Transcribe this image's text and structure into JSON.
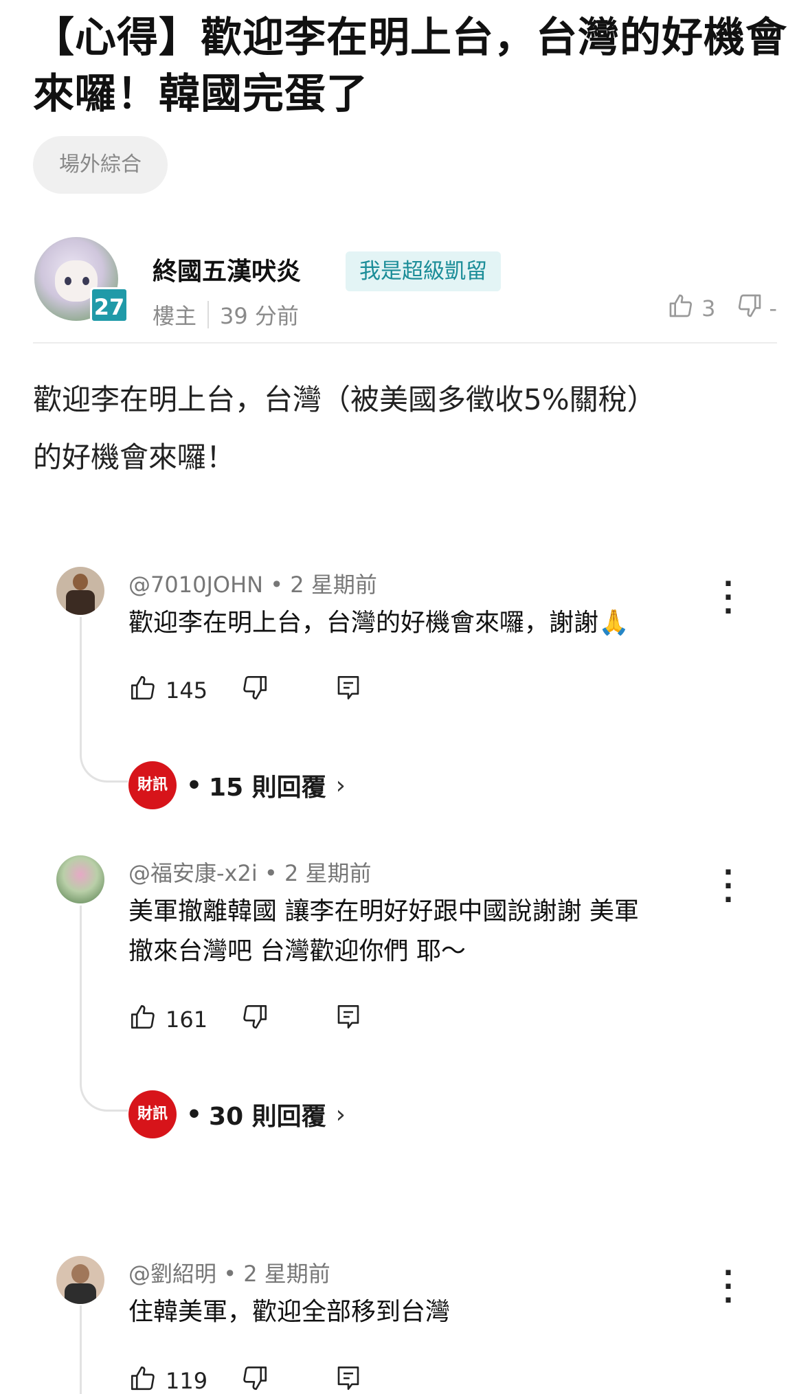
{
  "post": {
    "title": "【心得】歡迎李在明上台，台灣的好機會來囉！韓國完蛋了",
    "board": "場外綜合",
    "author": {
      "name": "終國五漢吠炎",
      "level": "27",
      "badge": "我是超級凱留",
      "role": "樓主",
      "time": "39 分前"
    },
    "likes": "3",
    "dislikes": "-",
    "body_line1": "歡迎李在明上台，台灣（被美國多徵收5%關稅）",
    "body_line2": "的好機會來囉！"
  },
  "comments": [
    {
      "user": "@7010JOHN",
      "time": "2 星期前",
      "text": "歡迎李在明上台，台灣的好機會來囉，謝謝🙏",
      "likes": "145",
      "reply_logo": "財訊",
      "replies": "15 則回覆"
    },
    {
      "user": "@福安康-x2i",
      "time": "2 星期前",
      "text_line1": "美軍撤離韓國 讓李在明好好跟中國說謝謝 美軍",
      "text_line2": "撤來台灣吧 台灣歡迎你們 耶～",
      "likes": "161",
      "reply_logo": "財訊",
      "replies": "30 則回覆"
    },
    {
      "user": "@劉紹明",
      "time": "2 星期前",
      "text": "住韓美軍，歡迎全部移到台灣",
      "likes": "119"
    }
  ],
  "separators": {
    "dot": "•"
  },
  "icons": {
    "like": "thumbs-up-icon",
    "dislike": "thumbs-down-icon",
    "reply": "reply-icon",
    "menu": "more-vertical-icon"
  },
  "colors": {
    "badge_bg": "#e3f4f5",
    "badge_text": "#1b8d98",
    "level_bg": "#1f9aa8",
    "reply_logo_bg": "#d7141a"
  }
}
